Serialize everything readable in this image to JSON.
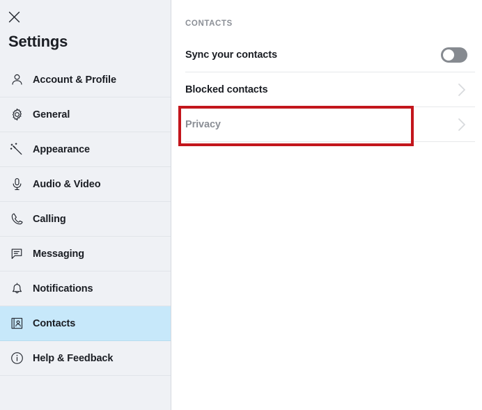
{
  "window": {
    "close_label": "Close",
    "title": "Settings"
  },
  "sidebar": {
    "items": [
      {
        "label": "Account & Profile",
        "icon": "person-icon",
        "active": false
      },
      {
        "label": "General",
        "icon": "gear-icon",
        "active": false
      },
      {
        "label": "Appearance",
        "icon": "magic-wand-icon",
        "active": false
      },
      {
        "label": "Audio & Video",
        "icon": "microphone-icon",
        "active": false
      },
      {
        "label": "Calling",
        "icon": "phone-icon",
        "active": false
      },
      {
        "label": "Messaging",
        "icon": "message-bubble-icon",
        "active": false
      },
      {
        "label": "Notifications",
        "icon": "bell-icon",
        "active": false
      },
      {
        "label": "Contacts",
        "icon": "contact-book-icon",
        "active": true
      },
      {
        "label": "Help & Feedback",
        "icon": "info-circle-icon",
        "active": false
      }
    ]
  },
  "main": {
    "section_header": "CONTACTS",
    "rows": [
      {
        "label": "Sync your contacts",
        "control": "toggle",
        "toggle_on": false,
        "muted": false
      },
      {
        "label": "Blocked contacts",
        "control": "chevron",
        "muted": false
      },
      {
        "label": "Privacy",
        "control": "chevron",
        "muted": true
      }
    ]
  },
  "annotation": {
    "highlight_color": "#c3161c",
    "highlight_target": "Privacy"
  }
}
